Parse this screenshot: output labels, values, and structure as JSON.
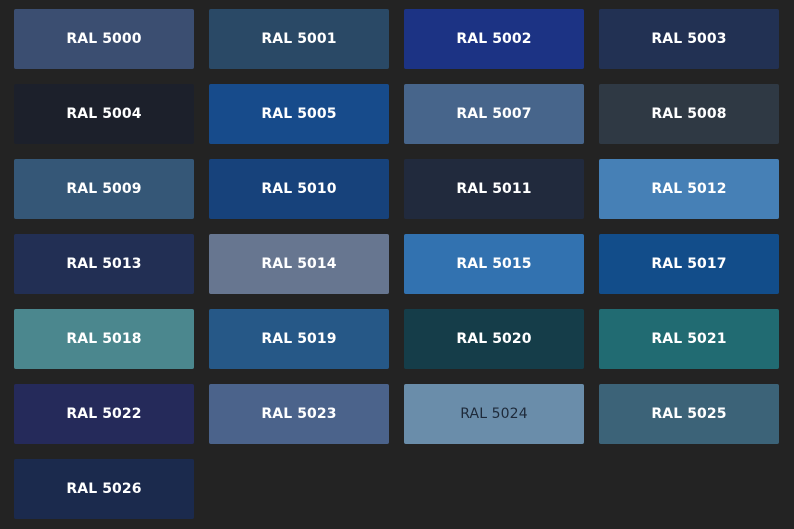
{
  "swatches": [
    {
      "label": "RAL 5000",
      "color": "#3b4e71",
      "text_color": "#ffffff"
    },
    {
      "label": "RAL 5001",
      "color": "#2a4966",
      "text_color": "#ffffff"
    },
    {
      "label": "RAL 5002",
      "color": "#1c3384",
      "text_color": "#ffffff"
    },
    {
      "label": "RAL 5003",
      "color": "#223153",
      "text_color": "#ffffff"
    },
    {
      "label": "RAL 5004",
      "color": "#1c202b",
      "text_color": "#ffffff"
    },
    {
      "label": "RAL 5005",
      "color": "#174b8b",
      "text_color": "#ffffff"
    },
    {
      "label": "RAL 5007",
      "color": "#47658b",
      "text_color": "#ffffff"
    },
    {
      "label": "RAL 5008",
      "color": "#2f3944",
      "text_color": "#ffffff"
    },
    {
      "label": "RAL 5009",
      "color": "#355777",
      "text_color": "#ffffff"
    },
    {
      "label": "RAL 5010",
      "color": "#17427b",
      "text_color": "#ffffff"
    },
    {
      "label": "RAL 5011",
      "color": "#212a3d",
      "text_color": "#ffffff"
    },
    {
      "label": "RAL 5012",
      "color": "#4680b6",
      "text_color": "#ffffff"
    },
    {
      "label": "RAL 5013",
      "color": "#222f54",
      "text_color": "#ffffff"
    },
    {
      "label": "RAL 5014",
      "color": "#677690",
      "text_color": "#ffffff"
    },
    {
      "label": "RAL 5015",
      "color": "#3272b0",
      "text_color": "#ffffff"
    },
    {
      "label": "RAL 5017",
      "color": "#124d8a",
      "text_color": "#ffffff"
    },
    {
      "label": "RAL 5018",
      "color": "#4b878e",
      "text_color": "#ffffff"
    },
    {
      "label": "RAL 5019",
      "color": "#265887",
      "text_color": "#ffffff"
    },
    {
      "label": "RAL 5020",
      "color": "#153d49",
      "text_color": "#ffffff"
    },
    {
      "label": "RAL 5021",
      "color": "#216b72",
      "text_color": "#ffffff"
    },
    {
      "label": "RAL 5022",
      "color": "#252a5a",
      "text_color": "#ffffff"
    },
    {
      "label": "RAL 5023",
      "color": "#4b638b",
      "text_color": "#ffffff"
    },
    {
      "label": "RAL 5024",
      "color": "#6a8daa",
      "text_color": "#1e2a3a"
    },
    {
      "label": "RAL 5025",
      "color": "#3c6378",
      "text_color": "#ffffff"
    },
    {
      "label": "RAL 5026",
      "color": "#1b2a4d",
      "text_color": "#ffffff"
    }
  ]
}
